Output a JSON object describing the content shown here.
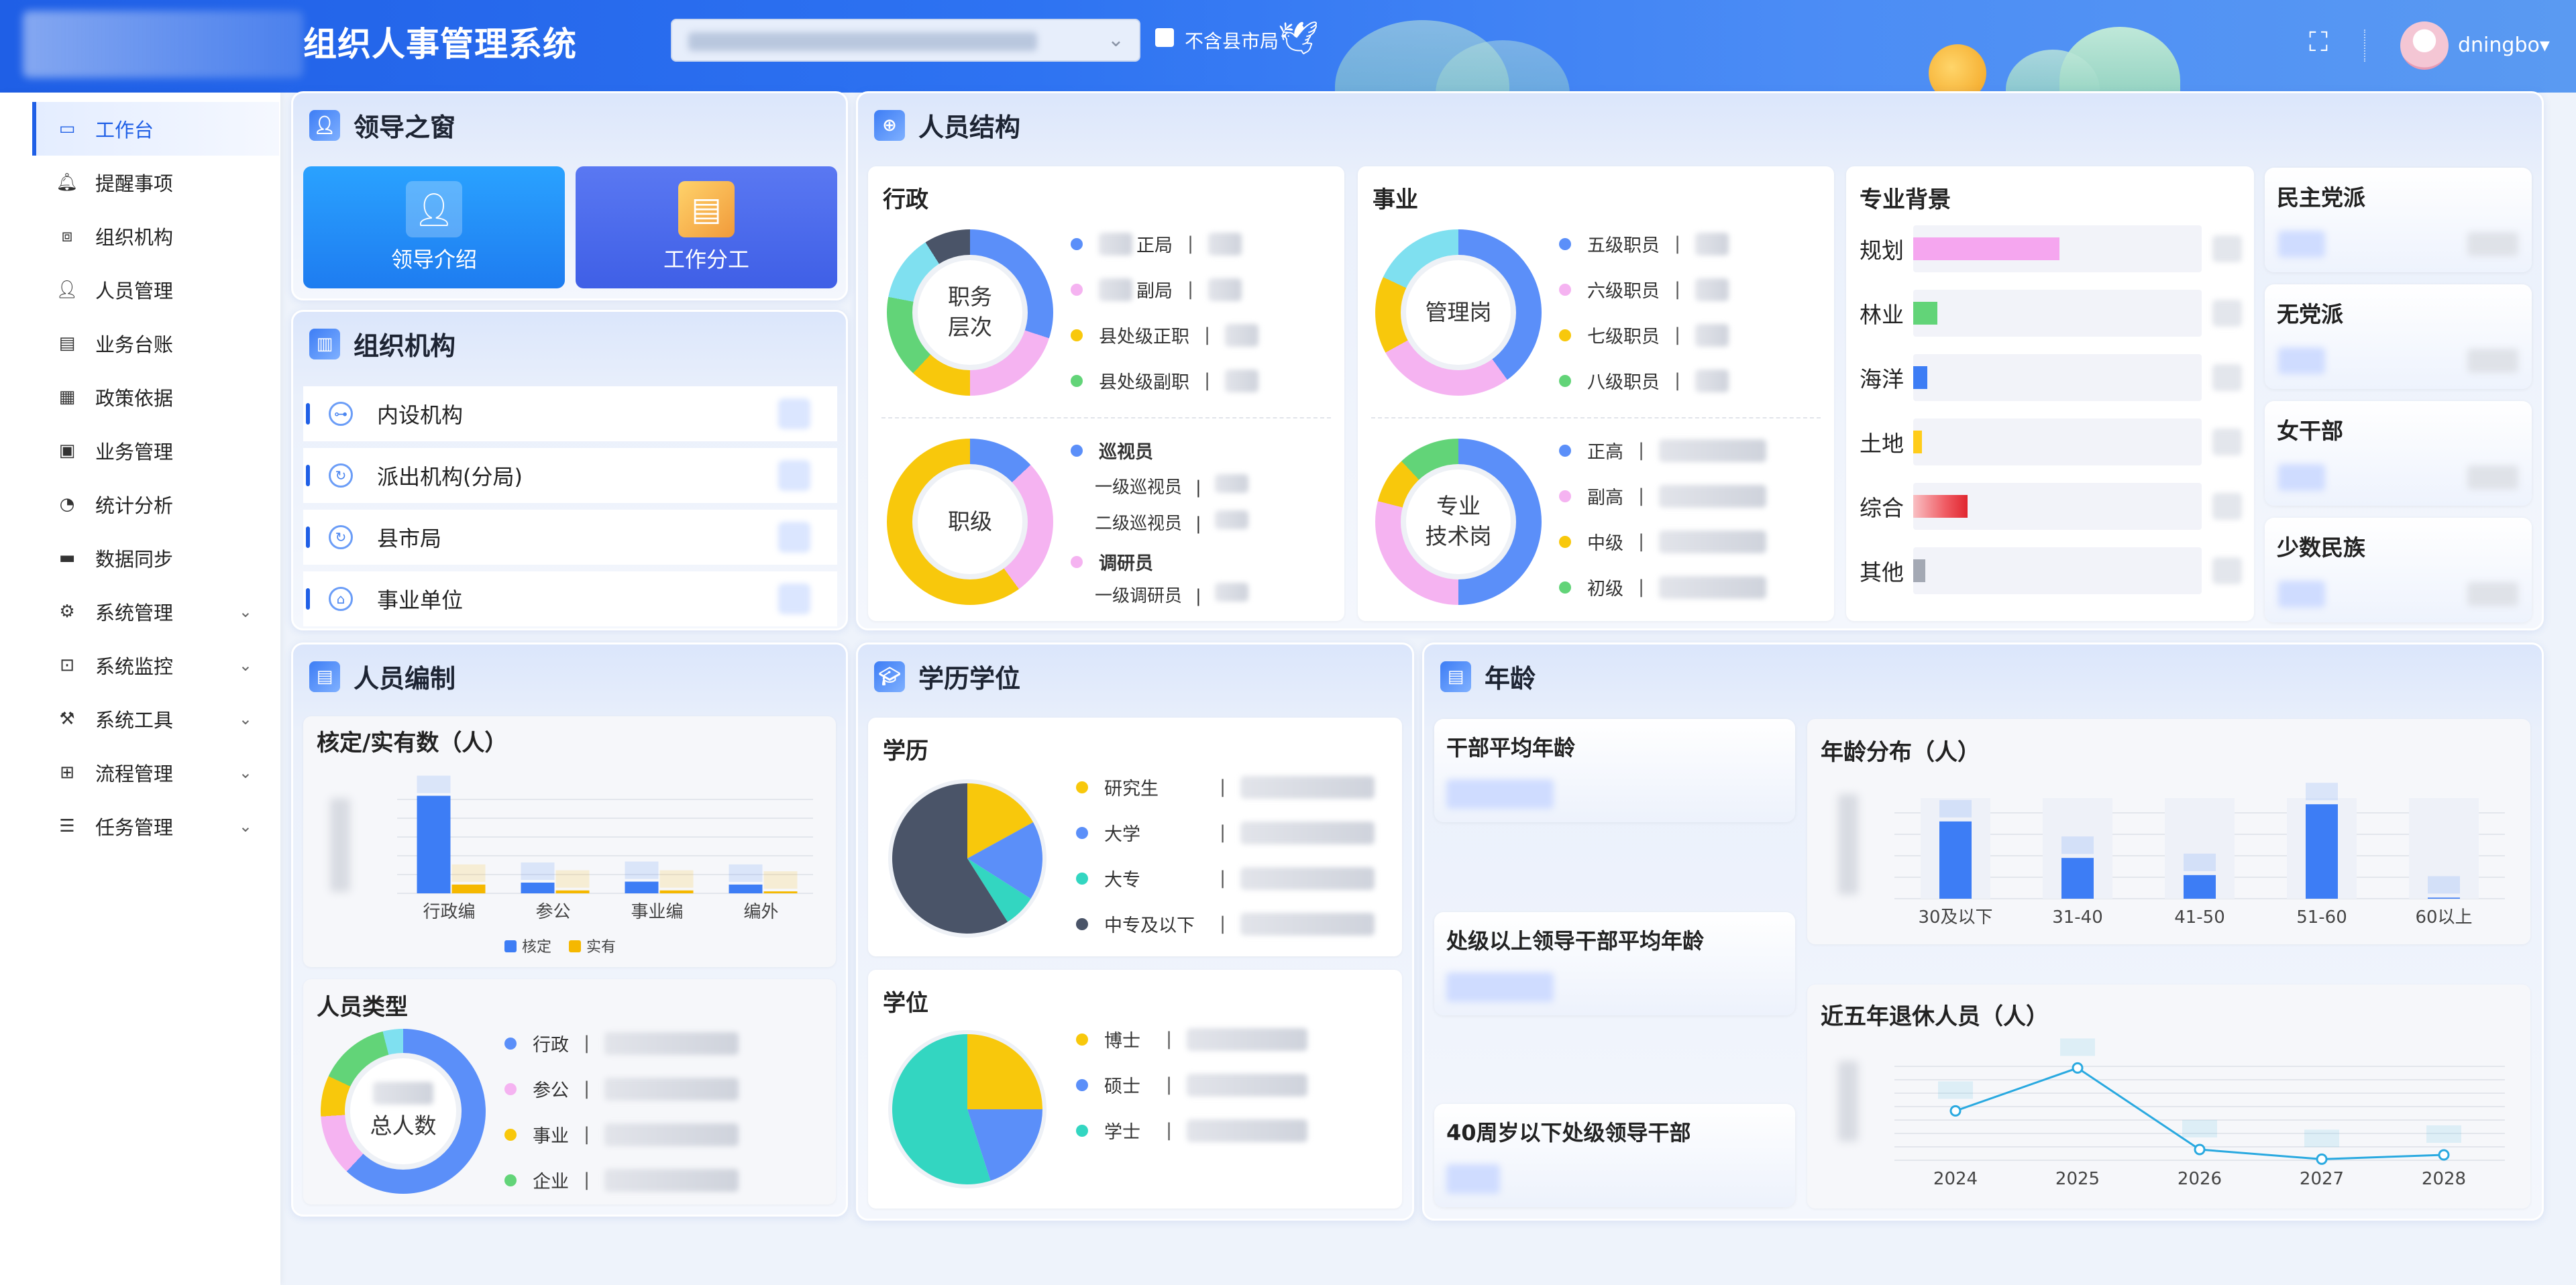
{
  "header": {
    "title": "组织人事管理系统",
    "checkbox_label": "不含县市局",
    "username": "dningbo",
    "user_caret": "▾"
  },
  "sidebar": {
    "items": [
      {
        "label": "工作台",
        "icon": "monitor-icon",
        "active": true
      },
      {
        "label": "提醒事项",
        "icon": "bell-icon"
      },
      {
        "label": "组织机构",
        "icon": "org-icon"
      },
      {
        "label": "人员管理",
        "icon": "user-icon"
      },
      {
        "label": "业务台账",
        "icon": "ledger-icon"
      },
      {
        "label": "政策依据",
        "icon": "doc-icon"
      },
      {
        "label": "业务管理",
        "icon": "briefcase-icon"
      },
      {
        "label": "统计分析",
        "icon": "pie-icon"
      },
      {
        "label": "数据同步",
        "icon": "folder-icon"
      },
      {
        "label": "系统管理",
        "icon": "gear-icon",
        "expandable": true
      },
      {
        "label": "系统监控",
        "icon": "monitor-chart-icon",
        "expandable": true
      },
      {
        "label": "系统工具",
        "icon": "tool-icon",
        "expandable": true
      },
      {
        "label": "流程管理",
        "icon": "flow-icon",
        "expandable": true
      },
      {
        "label": "任务管理",
        "icon": "tasks-icon",
        "expandable": true
      }
    ]
  },
  "leader": {
    "title": "领导之窗",
    "btn1": "领导介绍",
    "btn2": "工作分工"
  },
  "org": {
    "title": "组织机构",
    "rows": [
      "内设机构",
      "派出机构(分局)",
      "县市局",
      "事业单位"
    ]
  },
  "structure": {
    "title": "人员结构",
    "admin": {
      "title": "行政",
      "donut1_label": "职务\n层次",
      "donut1_legend": [
        "正局",
        "副局",
        "县处级正职",
        "县处级副职"
      ],
      "donut2_label": "职级",
      "donut2_groups": [
        {
          "head": "巡视员",
          "items": [
            "一级巡视员",
            "二级巡视员"
          ]
        },
        {
          "head": "调研员",
          "items": [
            "一级调研员"
          ]
        }
      ]
    },
    "career": {
      "title": "事业",
      "donut1_label": "管理岗",
      "donut1_legend": [
        "五级职员",
        "六级职员",
        "七级职员",
        "八级职员"
      ],
      "donut2_label": "专业\n技术岗",
      "donut2_legend": [
        "正高",
        "副高",
        "中级",
        "初级"
      ]
    },
    "background": {
      "title": "专业背景",
      "rows": [
        {
          "label": "规划",
          "value": 0.42,
          "color": "#f5a6ef"
        },
        {
          "label": "林业",
          "value": 0.07,
          "color": "#62d478"
        },
        {
          "label": "海洋",
          "value": 0.04,
          "color": "#3d7df5"
        },
        {
          "label": "土地",
          "value": 0.025,
          "color": "#ffcc1a"
        },
        {
          "label": "综合",
          "value": 0.155,
          "color": "#ef5a62"
        },
        {
          "label": "其他",
          "value": 0.035,
          "color": "#a4a9b4"
        }
      ]
    },
    "side": [
      "民主党派",
      "无党派",
      "女干部",
      "少数民族"
    ]
  },
  "staffing": {
    "title": "人员编制",
    "chart_title": "核定/实有数（人）",
    "legend": [
      "核定",
      "实有"
    ],
    "type_title": "人员类型",
    "type_center": "总人数",
    "type_legend": [
      "行政",
      "参公",
      "事业",
      "企业"
    ]
  },
  "education": {
    "title": "学历学位",
    "edu_title": "学历",
    "edu_legend": [
      "研究生",
      "大学",
      "大专",
      "中专及以下"
    ],
    "deg_title": "学位",
    "deg_legend": [
      "博士",
      "硕士",
      "学士"
    ]
  },
  "age": {
    "title": "年龄",
    "cards": [
      "干部平均年龄",
      "处级以上领导干部平均年龄",
      "40周岁以下处级领导干部"
    ],
    "dist_title": "年龄分布（人）",
    "retire_title": "近五年退休人员（人）"
  },
  "chart_data": [
    {
      "type": "bar",
      "title": "核定/实有数（人）",
      "categories": [
        "行政编",
        "参公",
        "事业编",
        "编外"
      ],
      "series": [
        {
          "name": "核定",
          "values": [
            100,
            11,
            12,
            9
          ],
          "color": "#3d7df5"
        },
        {
          "name": "实有",
          "values": [
            9,
            3,
            3,
            2
          ],
          "color": "#f5b800"
        }
      ]
    },
    {
      "type": "bar",
      "title": "年龄分布（人）",
      "categories": [
        "30及以下",
        "31-40",
        "41-50",
        "51-60",
        "60以上"
      ],
      "values": [
        72,
        38,
        22,
        88,
        1
      ],
      "color": "#3d7df5"
    },
    {
      "type": "line",
      "title": "近五年退休人员（人）",
      "x": [
        "2024",
        "2025",
        "2026",
        "2027",
        "2028"
      ],
      "values": [
        46,
        86,
        10,
        1,
        5
      ],
      "color": "#29a9e0"
    },
    {
      "type": "pie",
      "title": "学历",
      "labels": [
        "研究生",
        "大学",
        "大专",
        "中专及以下"
      ],
      "values": [
        17,
        17,
        7,
        59
      ],
      "colors": [
        "#f8c80c",
        "#5b8ff9",
        "#33d6c1",
        "#4a5468"
      ]
    },
    {
      "type": "pie",
      "title": "学位",
      "labels": [
        "博士",
        "硕士",
        "学士"
      ],
      "values": [
        25,
        20,
        55
      ],
      "colors": [
        "#f8c80c",
        "#5b8ff9",
        "#33d6c1"
      ]
    }
  ]
}
